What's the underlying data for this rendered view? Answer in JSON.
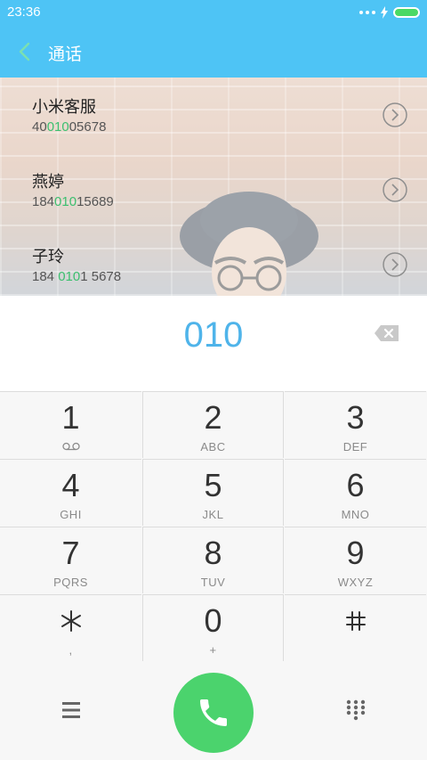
{
  "status_bar": {
    "time": "23:36"
  },
  "app_bar": {
    "title": "通话"
  },
  "results": [
    {
      "name": "小米客服",
      "number_prefix": "40",
      "number_match": "010",
      "number_suffix": "05678"
    },
    {
      "name": "燕婷",
      "number_prefix": "184",
      "number_match": "010",
      "number_suffix": "15689"
    },
    {
      "name": "子玲",
      "number_prefix": "184 ",
      "number_match": "010",
      "number_suffix": "1 5678"
    }
  ],
  "dial_input": {
    "value": "010"
  },
  "keypad": [
    {
      "num": "1",
      "letters": "voicemail"
    },
    {
      "num": "2",
      "letters": "ABC"
    },
    {
      "num": "3",
      "letters": "DEF"
    },
    {
      "num": "4",
      "letters": "GHI"
    },
    {
      "num": "5",
      "letters": "JKL"
    },
    {
      "num": "6",
      "letters": "MNO"
    },
    {
      "num": "7",
      "letters": "PQRS"
    },
    {
      "num": "8",
      "letters": "TUV"
    },
    {
      "num": "9",
      "letters": "WXYZ"
    },
    {
      "num": "*",
      "letters": ","
    },
    {
      "num": "0",
      "letters": "+"
    },
    {
      "num": "#",
      "letters": ""
    }
  ],
  "colors": {
    "accent": "#4ec4f5",
    "match": "#3cbf6f",
    "call": "#4bd36d",
    "digits": "#4fb4ea"
  },
  "icons": {
    "back": "chevron-left-icon",
    "backspace": "backspace-icon",
    "menu": "menu-icon",
    "call": "phone-icon",
    "dialpad": "dialpad-icon"
  }
}
